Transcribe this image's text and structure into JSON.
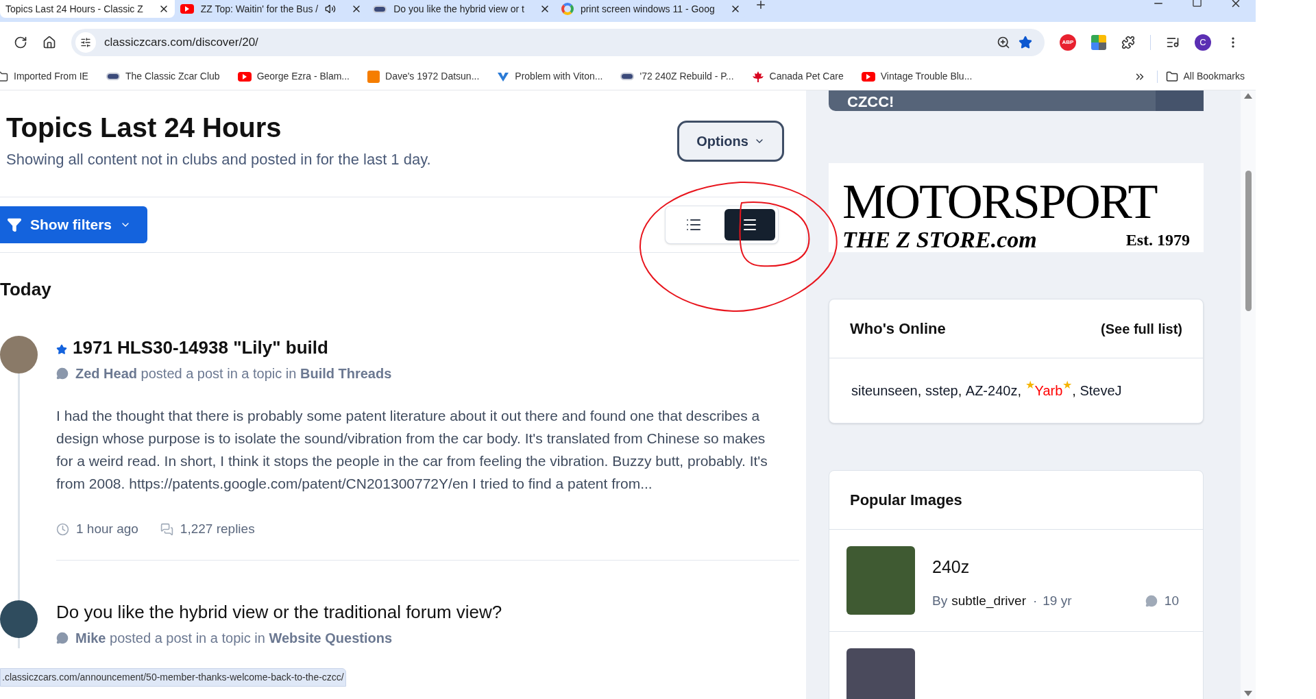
{
  "browser": {
    "tabs": [
      {
        "title": "Topics Last 24 Hours - Classic Z",
        "selected": true,
        "kind": "plain",
        "audio": false
      },
      {
        "title": "ZZ Top: Waitin' for the Bus /",
        "selected": false,
        "kind": "youtube",
        "audio": true
      },
      {
        "title": "Do you like the hybrid view or t",
        "selected": false,
        "kind": "club",
        "audio": false
      },
      {
        "title": "print screen windows 11 - Goog",
        "selected": false,
        "kind": "google",
        "audio": false
      }
    ],
    "url": "classiczcars.com/discover/20/",
    "bookmarked": true,
    "adblock": "ABP",
    "profile": "C",
    "bookmarks": [
      {
        "title": "Imported From IE",
        "kind": "folder"
      },
      {
        "title": "The Classic Zcar Club",
        "kind": "club"
      },
      {
        "title": "George Ezra - Blam...",
        "kind": "youtube"
      },
      {
        "title": "Dave's 1972 Datsun...",
        "kind": "blogger"
      },
      {
        "title": "Problem with Viton...",
        "kind": "check"
      },
      {
        "title": "'72 240Z Rebuild - P...",
        "kind": "club"
      },
      {
        "title": "Canada Pet Care",
        "kind": "maple"
      },
      {
        "title": "Vintage Trouble Blu...",
        "kind": "youtube"
      }
    ],
    "all_bookmarks": "All Bookmarks",
    "status_url": ".classiczcars.com/announcement/50-member-thanks-welcome-back-to-the-czcc/"
  },
  "page": {
    "title": "Topics Last 24 Hours",
    "subtitle": "Showing all content not in clubs and posted in for the last 1 day.",
    "options": "Options",
    "show_filters": "Show filters",
    "views": [
      {
        "kind": "expanded",
        "selected": false
      },
      {
        "kind": "condensed",
        "selected": true
      }
    ],
    "section": "Today",
    "posts": [
      {
        "title": "1971 HLS30-14938 \"Lily\" build",
        "starred": true,
        "meta": "**Zed Head** posted a post in a topic in **Build Threads**",
        "excerpt": "I had the thought that there is probably some patent literature about it out there and found one that describes a design whose purpose is to isolate the sound/vibration from the car body. It's translated from Chinese so makes for a weird read. In short, I think it stops the people in the car from feeling the vibration. Buzzy butt, probably. It's from 2008. https://patents.google.com/patent/CN201300772Y/en I tried to find a patent from...",
        "time": "1 hour ago",
        "replies": "1,227 replies"
      },
      {
        "title": "Do you like the hybrid view or the traditional forum view?",
        "starred": false,
        "meta": "**Mike** posted a post in a topic in **Website Questions**"
      }
    ]
  },
  "sidebar": {
    "banner_text": "CZCC!",
    "ad": {
      "line1": "MOTORSPORT",
      "line2": "THE Z STORE.com",
      "line3": "Est. 1979"
    },
    "whos_online": {
      "title": "Who's Online",
      "link": "(See full list)",
      "separator": ", ",
      "users": [
        {
          "name": "siteunseen",
          "color": "#111827"
        },
        {
          "name": "sstep",
          "color": "#111827"
        },
        {
          "name": "AZ-240z",
          "color": "#111827"
        },
        {
          "name": "Yarb",
          "color": "#ff0000",
          "badge": "★"
        },
        {
          "name": "SteveJ",
          "color": "#111827"
        }
      ]
    },
    "popular_images": {
      "title": "Popular Images",
      "items": [
        {
          "kind": "full",
          "title": "240z",
          "by": "By",
          "author": "subtle_driver",
          "dot": "·",
          "age": "19 yr",
          "comments": "10"
        },
        {
          "kind": "thumbnail"
        }
      ]
    }
  }
}
